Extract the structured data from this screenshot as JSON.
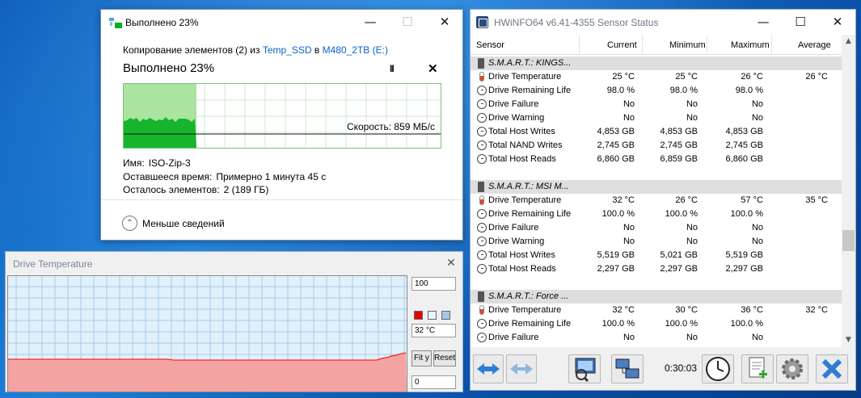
{
  "copy_dialog": {
    "title": "Выполнено 23%",
    "info_prefix": "Копирование элементов (2) из ",
    "info_source": "Temp_SSD",
    "info_mid": " в ",
    "info_dest": "M480_2TB (E:)",
    "percent_text": "Выполнено 23%",
    "progress": 0.23,
    "pause_label": "II",
    "stop_label": "✕",
    "speed_text": "Скорость: 859 МБ/с",
    "name_label": "Имя:",
    "name_value": "ISO-Zip-3",
    "time_label": "Оставшееся время:",
    "time_value": "Примерно 1 минута 45 с",
    "items_label": "Осталось элементов:",
    "items_value": "2 (189 ГБ)",
    "less_details_label": "Меньше сведений",
    "accent_color": "#06b025"
  },
  "temp_window": {
    "title": "Drive Temperature",
    "max_value": "100",
    "current_value": "32 °C",
    "min_value": "0",
    "fit_label": "Fit y",
    "reset_label": "Reset",
    "line_color": "#ff0000",
    "fill_color": "#f4a3a3"
  },
  "hwinfo": {
    "title": "HWiNFO64 v6.41-4355 Sensor Status",
    "headers": {
      "sensor": "Sensor",
      "current": "Current",
      "minimum": "Minimum",
      "maximum": "Maximum",
      "average": "Average"
    },
    "elapsed": "0:30:03",
    "rows": [
      {
        "kind": "group",
        "sensor": "S.M.A.R.T.: KINGS..."
      },
      {
        "kind": "therm",
        "sensor": "Drive Temperature",
        "cur": "25 °C",
        "min": "25 °C",
        "max": "26 °C",
        "avg": "26 °C"
      },
      {
        "kind": "clock",
        "sensor": "Drive Remaining Life",
        "cur": "98.0 %",
        "min": "98.0 %",
        "max": "98.0 %",
        "avg": ""
      },
      {
        "kind": "clock",
        "sensor": "Drive Failure",
        "cur": "No",
        "min": "No",
        "max": "No",
        "avg": ""
      },
      {
        "kind": "clock",
        "sensor": "Drive Warning",
        "cur": "No",
        "min": "No",
        "max": "No",
        "avg": ""
      },
      {
        "kind": "clock",
        "sensor": "Total Host Writes",
        "cur": "4,853 GB",
        "min": "4,853 GB",
        "max": "4,853 GB",
        "avg": ""
      },
      {
        "kind": "clock",
        "sensor": "Total NAND Writes",
        "cur": "2,745 GB",
        "min": "2,745 GB",
        "max": "2,745 GB",
        "avg": ""
      },
      {
        "kind": "clock",
        "sensor": "Total Host Reads",
        "cur": "6,860 GB",
        "min": "6,859 GB",
        "max": "6,860 GB",
        "avg": ""
      },
      {
        "kind": "blank"
      },
      {
        "kind": "group",
        "sensor": "S.M.A.R.T.: MSI M..."
      },
      {
        "kind": "therm",
        "sensor": "Drive Temperature",
        "cur": "32 °C",
        "min": "26 °C",
        "max": "57 °C",
        "avg": "35 °C"
      },
      {
        "kind": "clock",
        "sensor": "Drive Remaining Life",
        "cur": "100.0 %",
        "min": "100.0 %",
        "max": "100.0 %",
        "avg": ""
      },
      {
        "kind": "clock",
        "sensor": "Drive Failure",
        "cur": "No",
        "min": "No",
        "max": "No",
        "avg": ""
      },
      {
        "kind": "clock",
        "sensor": "Drive Warning",
        "cur": "No",
        "min": "No",
        "max": "No",
        "avg": ""
      },
      {
        "kind": "clock",
        "sensor": "Total Host Writes",
        "cur": "5,519 GB",
        "min": "5,021 GB",
        "max": "5,519 GB",
        "avg": ""
      },
      {
        "kind": "clock",
        "sensor": "Total Host Reads",
        "cur": "2,297 GB",
        "min": "2,297 GB",
        "max": "2,297 GB",
        "avg": ""
      },
      {
        "kind": "blank"
      },
      {
        "kind": "group",
        "sensor": "S.M.A.R.T.: Force ..."
      },
      {
        "kind": "therm",
        "sensor": "Drive Temperature",
        "cur": "32 °C",
        "min": "30 °C",
        "max": "36 °C",
        "avg": "32 °C"
      },
      {
        "kind": "clock",
        "sensor": "Drive Remaining Life",
        "cur": "100.0 %",
        "min": "100.0 %",
        "max": "100.0 %",
        "avg": ""
      },
      {
        "kind": "clock",
        "sensor": "Drive Failure",
        "cur": "No",
        "min": "No",
        "max": "No",
        "avg": ""
      }
    ],
    "toolbar_icons": [
      "arrows-left-right-icon",
      "arrows-left-right-disabled-icon",
      "search-monitor-icon",
      "network-icon",
      "clock-icon",
      "report-add-icon",
      "settings-gear-icon",
      "close-x-icon"
    ]
  }
}
